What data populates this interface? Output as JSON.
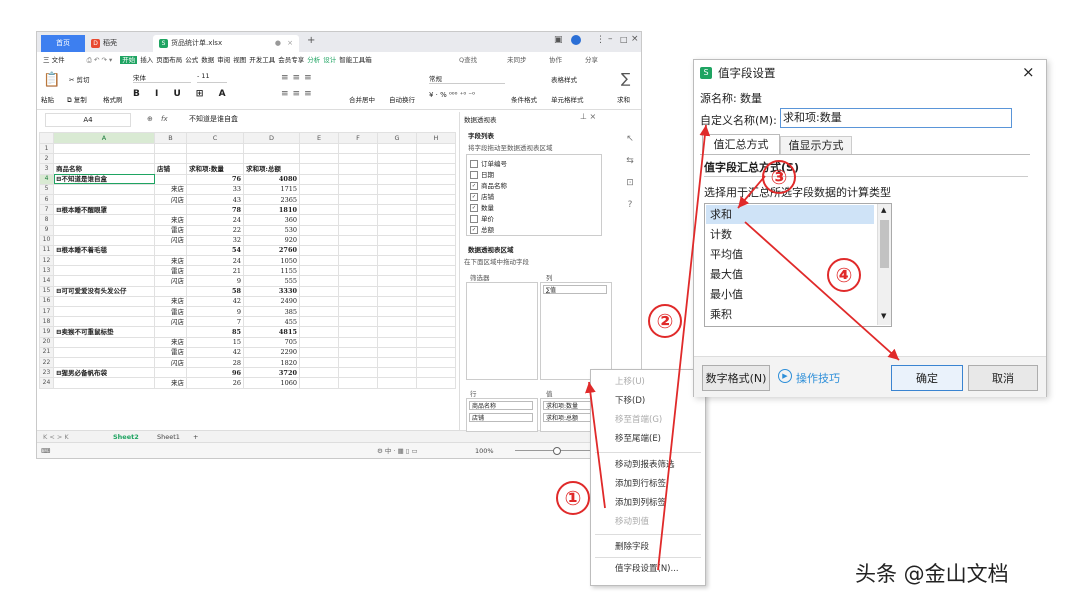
{
  "spreadsheet": {
    "tabs": [
      {
        "label": "首页"
      },
      {
        "label": "稻壳"
      },
      {
        "label": "货品统计单.xlsx"
      }
    ],
    "menu": {
      "file_label": "三 文件",
      "items": [
        "开始",
        "插入",
        "页面布局",
        "公式",
        "数据",
        "审阅",
        "视图",
        "开发工具",
        "会员专享",
        "分析",
        "设计",
        "智能工具箱"
      ],
      "search_label": "Q查找",
      "sync_label": "未同步",
      "collab_label": "协作",
      "share_label": "分享"
    },
    "ribbon": {
      "cut": "剪切",
      "paste": "粘贴",
      "copy": "复制",
      "format_painter": "格式刷",
      "font_name": "宋体",
      "font_size": "11",
      "merge": "合并居中",
      "wrap": "自动换行",
      "number_format": "常规",
      "conditional": "条件格式",
      "table_style": "表格样式",
      "cell_style": "单元格样式",
      "sum": "求和"
    },
    "formula_bar": {
      "cell_ref": "A4",
      "fx": "fx",
      "value": "不知道是谁自盒"
    },
    "columns": [
      "A",
      "B",
      "C",
      "D",
      "E",
      "F",
      "G",
      "H"
    ],
    "rows": [
      {
        "n": "1",
        "a": "",
        "b": "",
        "c": "",
        "d": ""
      },
      {
        "n": "2",
        "a": "",
        "b": "",
        "c": "",
        "d": ""
      },
      {
        "n": "3",
        "a": "商品名称",
        "b": "店铺",
        "c": "求和项:数量",
        "d": "求和项:总额",
        "hdr": true
      },
      {
        "n": "4",
        "a": "⊟不知道是谁自盒",
        "b": "",
        "c": "76",
        "d": "4080",
        "bold": true
      },
      {
        "n": "5",
        "a": "",
        "b": "来店",
        "c": "33",
        "d": "1715"
      },
      {
        "n": "6",
        "a": "",
        "b": "闪店",
        "c": "43",
        "d": "2365"
      },
      {
        "n": "7",
        "a": "⊟根本睡不醒眼罩",
        "b": "",
        "c": "78",
        "d": "1810",
        "bold": true
      },
      {
        "n": "8",
        "a": "",
        "b": "来店",
        "c": "24",
        "d": "360"
      },
      {
        "n": "9",
        "a": "",
        "b": "雷店",
        "c": "22",
        "d": "530"
      },
      {
        "n": "10",
        "a": "",
        "b": "闪店",
        "c": "32",
        "d": "920"
      },
      {
        "n": "11",
        "a": "⊟根本睡不着毛毯",
        "b": "",
        "c": "54",
        "d": "2760",
        "bold": true
      },
      {
        "n": "12",
        "a": "",
        "b": "来店",
        "c": "24",
        "d": "1050"
      },
      {
        "n": "13",
        "a": "",
        "b": "雷店",
        "c": "21",
        "d": "1155"
      },
      {
        "n": "14",
        "a": "",
        "b": "闪店",
        "c": "9",
        "d": "555"
      },
      {
        "n": "15",
        "a": "⊟可可爱爱没有头发公仔",
        "b": "",
        "c": "58",
        "d": "3330",
        "bold": true
      },
      {
        "n": "16",
        "a": "",
        "b": "来店",
        "c": "42",
        "d": "2490"
      },
      {
        "n": "17",
        "a": "",
        "b": "雷店",
        "c": "9",
        "d": "385"
      },
      {
        "n": "18",
        "a": "",
        "b": "闪店",
        "c": "7",
        "d": "455"
      },
      {
        "n": "19",
        "a": "⊟卖猴不可重鼠标垫",
        "b": "",
        "c": "85",
        "d": "4815",
        "bold": true
      },
      {
        "n": "20",
        "a": "",
        "b": "来店",
        "c": "15",
        "d": "705"
      },
      {
        "n": "21",
        "a": "",
        "b": "雷店",
        "c": "42",
        "d": "2290"
      },
      {
        "n": "22",
        "a": "",
        "b": "闪店",
        "c": "28",
        "d": "1820"
      },
      {
        "n": "23",
        "a": "⊟猩男必备帆布袋",
        "b": "",
        "c": "96",
        "d": "3720",
        "bold": true
      },
      {
        "n": "24",
        "a": "",
        "b": "来店",
        "c": "26",
        "d": "1060"
      }
    ],
    "sheet_tabs": [
      "Sheet2",
      "Sheet1"
    ],
    "zoom": "100%"
  },
  "pivot_pane": {
    "title": "数据透视表",
    "field_list_label": "字段列表",
    "field_hint": "将字段拖动至数据透视表区域",
    "fields": [
      {
        "label": "订单编号",
        "checked": false
      },
      {
        "label": "日期",
        "checked": false
      },
      {
        "label": "商品名称",
        "checked": true
      },
      {
        "label": "店铺",
        "checked": true
      },
      {
        "label": "数量",
        "checked": true
      },
      {
        "label": "单价",
        "checked": false
      },
      {
        "label": "总额",
        "checked": true
      }
    ],
    "areas_label": "数据透视表区域",
    "areas_hint": "在下面区域中拖动字段",
    "filter_label": "筛选器",
    "columns_label": "列",
    "columns_item": "∑值",
    "rows_label": "行",
    "rows_items": [
      "商品名称",
      "店铺"
    ],
    "values_label": "值",
    "values_items": [
      "求和项:数量",
      "求和项:总额"
    ]
  },
  "context_menu": {
    "items": [
      {
        "label": "上移(U)",
        "disabled": true
      },
      {
        "label": "下移(D)",
        "disabled": false
      },
      {
        "label": "移至首端(G)",
        "disabled": true
      },
      {
        "label": "移至尾端(E)",
        "disabled": false
      },
      {
        "label": "移动到报表筛选",
        "disabled": false
      },
      {
        "label": "添加到行标签",
        "disabled": false
      },
      {
        "label": "添加到列标签",
        "disabled": false
      },
      {
        "label": "移动到值",
        "disabled": true
      },
      {
        "label": "删除字段",
        "disabled": false
      },
      {
        "label": "值字段设置(N)...",
        "disabled": false
      }
    ]
  },
  "dialog": {
    "title": "值字段设置",
    "source_label": "源名称:",
    "source_value": "数量",
    "custom_name_label": "自定义名称(M):",
    "custom_name_value": "求和项:数量",
    "tabs": [
      "值汇总方式",
      "值显示方式"
    ],
    "section_title": "值字段汇总方式(S)",
    "section_hint": "选择用于汇总所选字段数据的计算类型",
    "list_items": [
      "求和",
      "计数",
      "平均值",
      "最大值",
      "最小值",
      "乘积"
    ],
    "selected_item": "求和",
    "number_format_btn": "数字格式(N)",
    "tips_label": "操作技巧",
    "ok_btn": "确定",
    "cancel_btn": "取消"
  },
  "annotations": {
    "step1": "①",
    "step2": "②",
    "step3": "③",
    "step4": "④",
    "color": "#e02a2a"
  },
  "watermark": "头条 @金山文档"
}
